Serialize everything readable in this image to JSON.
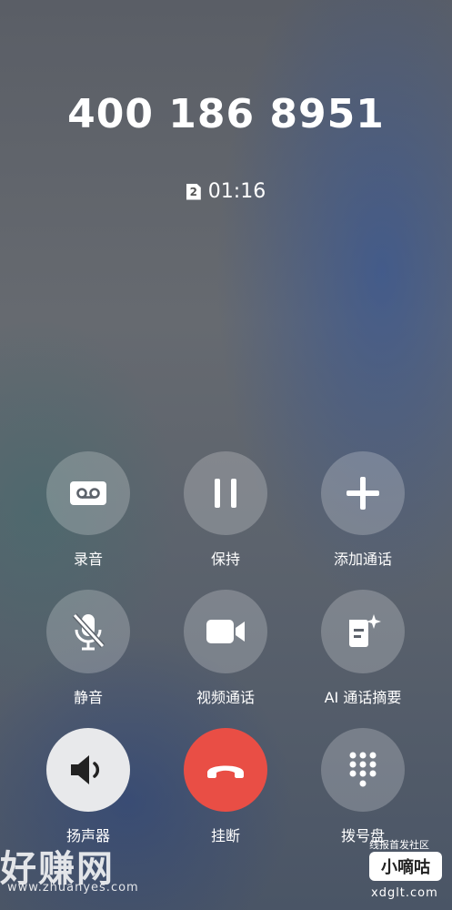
{
  "call": {
    "number": "400 186 8951",
    "sim_slot": "2",
    "duration": "01:16"
  },
  "controls": [
    {
      "label": "录音",
      "icon": "record-icon"
    },
    {
      "label": "保持",
      "icon": "pause-icon"
    },
    {
      "label": "添加通话",
      "icon": "plus-icon"
    },
    {
      "label": "静音",
      "icon": "mic-off-icon"
    },
    {
      "label": "视频通话",
      "icon": "video-camera-icon"
    },
    {
      "label": "AI 通话摘要",
      "icon": "ai-summary-icon"
    },
    {
      "label": "扬声器",
      "icon": "speaker-icon"
    },
    {
      "label": "挂断",
      "icon": "hang-up-icon"
    },
    {
      "label": "拨号盘",
      "icon": "dialpad-icon"
    }
  ],
  "colors": {
    "hangup": "#e94e45",
    "speaker_active": "#e8e9eb"
  },
  "watermark": {
    "left_logo": "好赚网",
    "left_url": "www.zhuanyes.com",
    "right_tagline": "线报首发社区",
    "right_logo": "小嘀咕",
    "right_url": "xdglt.com"
  }
}
